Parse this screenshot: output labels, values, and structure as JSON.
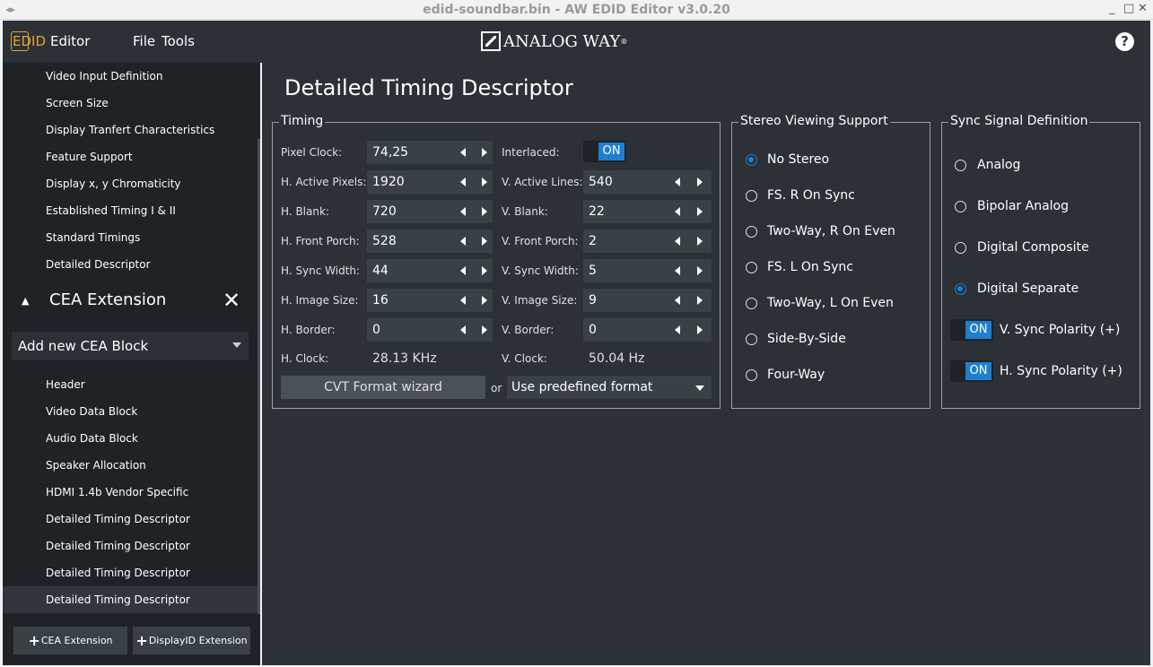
{
  "window": {
    "title": "edid-soundbar.bin - AW EDID Editor v3.0.20",
    "minimize": "_",
    "maximize": "□",
    "close": "✕"
  },
  "appbar": {
    "logo_text": "EDID",
    "logo_editor": "Editor",
    "menu_file": "File",
    "menu_tools": "Tools",
    "brand": "ANALOG WAY",
    "brand_reg": "®",
    "help": "?"
  },
  "sidebar": {
    "items": [
      "Video Input Definition",
      "Screen Size",
      "Display Tranfert Characteristics",
      "Feature Support",
      "Display x, y Chromaticity",
      "Established Timing I & II",
      "Standard Timings",
      "Detailed Descriptor"
    ],
    "cea_label": "CEA Extension",
    "add_cea_block": "Add new CEA Block",
    "cea_items": [
      "Header",
      "Video Data Block",
      "Audio Data Block",
      "Speaker Allocation",
      "HDMI 1.4b Vendor Specific",
      "Detailed Timing Descriptor",
      "Detailed Timing Descriptor",
      "Detailed Timing Descriptor",
      "Detailed Timing Descriptor"
    ],
    "btn_cea_ext": "CEA Extension",
    "btn_displayid_ext": "DisplayID Extension"
  },
  "main": {
    "title": "Detailed Timing Descriptor",
    "timing": {
      "title": "Timing",
      "pixel_clock_label": "Pixel Clock:",
      "pixel_clock": "74,25",
      "interlaced_label": "Interlaced:",
      "interlaced_state": "ON",
      "h_active_label": "H. Active Pixels:",
      "h_active": "1920",
      "v_active_label": "V. Active Lines:",
      "v_active": "540",
      "h_blank_label": "H. Blank:",
      "h_blank": "720",
      "v_blank_label": "V. Blank:",
      "v_blank": "22",
      "h_front_label": "H. Front Porch:",
      "h_front": "528",
      "v_front_label": "V. Front Porch:",
      "v_front": "2",
      "h_sync_label": "H. Sync Width:",
      "h_sync": "44",
      "v_sync_label": "V. Sync Width:",
      "v_sync": "5",
      "h_image_label": "H. Image Size:",
      "h_image": "16",
      "v_image_label": "V. Image Size:",
      "v_image": "9",
      "h_border_label": "H. Border:",
      "h_border": "0",
      "v_border_label": "V. Border:",
      "v_border": "0",
      "h_clock_label": "H. Clock:",
      "h_clock": "28.13 KHz",
      "v_clock_label": "V. Clock:",
      "v_clock": "50.04 Hz",
      "cvt_button": "CVT Format wizard",
      "or": "or",
      "predefined": "Use predefined format"
    },
    "stereo": {
      "title": "Stereo Viewing Support",
      "options": [
        "No Stereo",
        "FS. R On Sync",
        "Two-Way, R On Even",
        "FS. L On Sync",
        "Two-Way, L On Even",
        "Side-By-Side",
        "Four-Way"
      ],
      "selected": "No Stereo"
    },
    "sync": {
      "title": "Sync Signal Definition",
      "options": [
        "Analog",
        "Bipolar Analog",
        "Digital Composite",
        "Digital Separate"
      ],
      "selected": "Digital Separate",
      "v_polarity_state": "ON",
      "v_polarity_label": "V. Sync Polarity (+)",
      "h_polarity_state": "ON",
      "h_polarity_label": "H. Sync Polarity (+)"
    }
  },
  "colors": {
    "accent": "#1e7fd0",
    "logo": "#e8a233",
    "panel": "#2b3137",
    "sidebar": "#1f2327"
  }
}
